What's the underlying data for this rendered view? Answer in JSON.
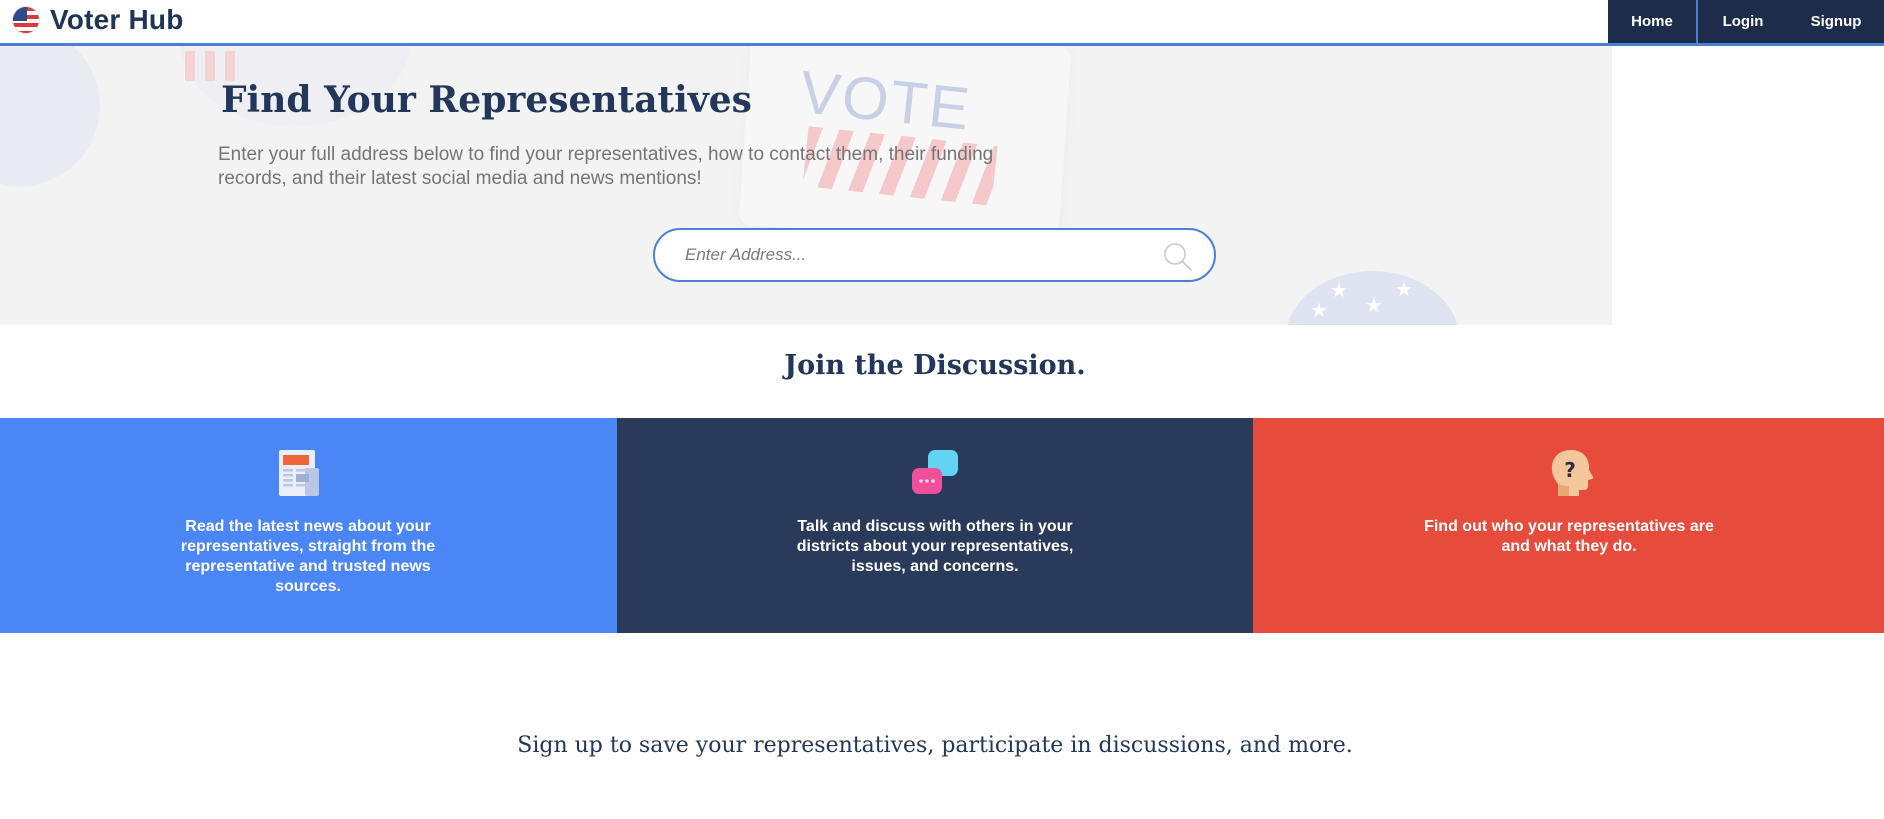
{
  "app": {
    "brand_name": "Voter Hub",
    "brand_logo_icon": "us-flag-badge-icon"
  },
  "nav": {
    "items": [
      {
        "label": "Home"
      },
      {
        "label": "Login"
      },
      {
        "label": "Signup"
      }
    ]
  },
  "hero": {
    "title": "Find Your Representatives",
    "description": "Enter your full address below to find your representatives, how to contact them, their funding records, and their latest social media and news mentions!",
    "background_vote_text": "VOTE",
    "search": {
      "placeholder": "Enter Address...",
      "value": "",
      "icon": "search-icon"
    }
  },
  "discussion": {
    "heading": "Join the Discussion.",
    "features": [
      {
        "icon": "newspaper-icon",
        "text": "Read the latest news about your representatives, straight from the representative and trusted news sources."
      },
      {
        "icon": "chat-bubbles-icon",
        "text": "Talk and discuss with others in your districts about your representatives, issues, and concerns."
      },
      {
        "icon": "head-question-icon",
        "text": "Find out who your representatives are and what they do."
      }
    ]
  },
  "cta": {
    "text": "Sign up to save your representatives, participate in discussions, and more."
  },
  "colors": {
    "accent": "#4a7fd3",
    "navy": "#1c2c4a",
    "title": "#22375a",
    "news_panel": "#4a86f5",
    "discuss_panel": "#2a3a5a",
    "reps_panel": "#e64b3c"
  }
}
